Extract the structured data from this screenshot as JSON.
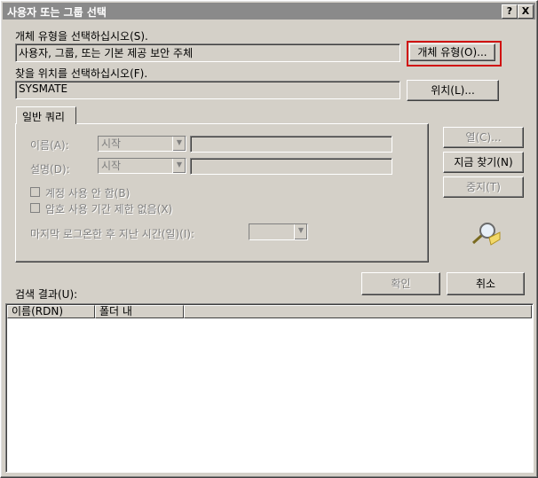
{
  "window": {
    "title": "사용자 또는 그룹 선택",
    "help_button": "?",
    "close_button": "X"
  },
  "object_type": {
    "label": "개체 유형을 선택하십시오(S).",
    "value": "사용자, 그룹, 또는 기본 제공 보안 주체",
    "button": "개체 유형(O)..."
  },
  "location": {
    "label": "찾을 위치를 선택하십시오(F).",
    "value": "SYSMATE",
    "button": "위치(L)..."
  },
  "query": {
    "tab": "일반 쿼리",
    "name_label": "이름(A):",
    "name_mode": "시작",
    "name_value": "",
    "desc_label": "설명(D):",
    "desc_mode": "시작",
    "desc_value": "",
    "disabled_accounts": "계정 사용 안 함(B)",
    "non_expiring_password": "암호 사용 기간 제한 없음(X)",
    "days_since_logon_label": "마지막 로그온한 후 지난 시간(일)(I):",
    "days_since_logon_value": ""
  },
  "side_buttons": {
    "columns": "열(C)...",
    "find_now": "지금 찾기(N)",
    "stop": "중지(T)"
  },
  "ok_button": "확인",
  "cancel_button": "취소",
  "results": {
    "label": "검색 결과(U):",
    "columns": [
      "이름(RDN)",
      "폴더 내"
    ],
    "rows": []
  }
}
